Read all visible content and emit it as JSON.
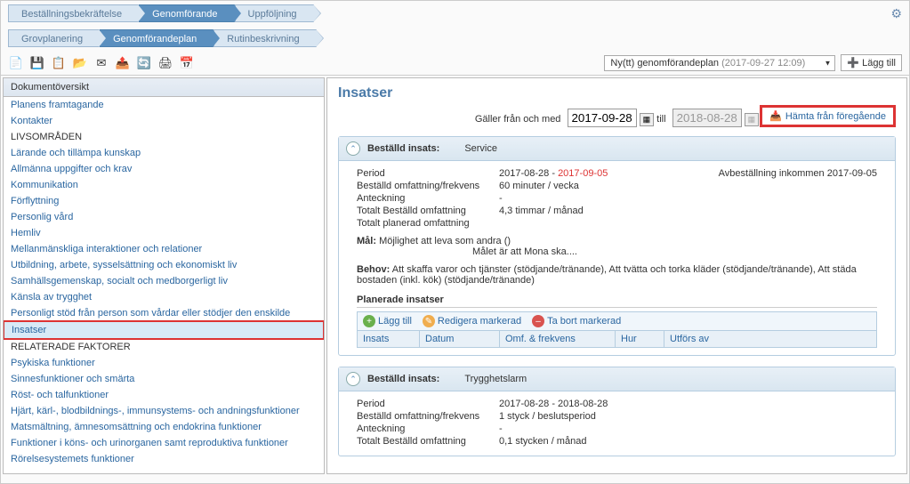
{
  "nav1": {
    "items": [
      "Beställningsbekräftelse",
      "Genomförande",
      "Uppföljning"
    ],
    "active": 1
  },
  "nav2": {
    "items": [
      "Grovplanering",
      "Genomförandeplan",
      "Rutinbeskrivning"
    ],
    "active": 1
  },
  "toolbar": {
    "version_label": "Ny(tt) genomförandeplan",
    "version_time": "(2017-09-27 12:09)",
    "lagg_till": "Lägg till"
  },
  "left": {
    "header": "Dokumentöversikt",
    "items": [
      "Planens framtagande",
      "Kontakter",
      "LIVSOMRÅDEN",
      "Lärande och tillämpa kunskap",
      "Allmänna uppgifter och krav",
      "Kommunikation",
      "Förflyttning",
      "Personlig vård",
      "Hemliv",
      "Mellanmänskliga interaktioner och relationer",
      "Utbildning, arbete, sysselsättning och ekonomiskt liv",
      "Samhällsgemenskap, socialt och medborgerligt liv",
      "Känsla av trygghet",
      "Personligt stöd från person som vårdar eller stödjer den enskilde",
      "Insatser",
      "RELATERADE FAKTORER",
      "Psykiska funktioner",
      "Sinnesfunktioner och smärta",
      "Röst- och talfunktioner",
      "Hjärt, kärl-, blodbildnings-, immunsystems- och andningsfunktioner",
      "Matsmältning, ämnesomsättning och endokrina funktioner",
      "Funktioner i köns- och urinorganen samt reproduktiva funktioner",
      "Rörelsesystemets funktioner"
    ],
    "selected_index": 14
  },
  "right": {
    "title": "Insatser",
    "date_label_from": "Gäller från och med",
    "date_from": "2017-09-28",
    "date_label_to": "till",
    "date_to": "2018-08-28",
    "hamta_btn": "Hämta från föregående",
    "panels": [
      {
        "title": "Beställd insats:",
        "value": "Service",
        "period_label": "Period",
        "period_from": "2017-08-28",
        "period_dash": " - ",
        "period_to": "2017-09-05",
        "avbest": "Avbeställning inkommen 2017-09-05",
        "rows": [
          {
            "label": "Beställd omfattning/frekvens",
            "value": "60 minuter / vecka"
          },
          {
            "label": "Anteckning",
            "value": "-"
          },
          {
            "label": "Totalt Beställd omfattning",
            "value": "4,3 timmar / månad"
          },
          {
            "label": "Totalt planerad omfattning",
            "value": ""
          }
        ],
        "mal_label": "Mål:",
        "mal_text": "Möjlighet att leva som andra ()",
        "mal_sub": "Målet är att Mona ska....",
        "behov_label": "Behov:",
        "behov_text": "Att skaffa varor och tjänster (stödjande/tränande), Att tvätta och torka kläder (stödjande/tränande), Att städa bostaden (inkl. kök) (stödjande/tränande)",
        "planerade_title": "Planerade insatser",
        "actions": {
          "add": "Lägg till",
          "edit": "Redigera markerad",
          "del": "Ta bort markerad"
        },
        "columns": [
          "Insats",
          "Datum",
          "Omf. & frekvens",
          "Hur",
          "Utförs av"
        ]
      },
      {
        "title": "Beställd insats:",
        "value": "Trygghetslarm",
        "period_label": "Period",
        "period_value": "2017-08-28 - 2018-08-28",
        "rows": [
          {
            "label": "Beställd omfattning/frekvens",
            "value": "1 styck / beslutsperiod"
          },
          {
            "label": "Anteckning",
            "value": "-"
          },
          {
            "label": "Totalt Beställd omfattning",
            "value": "0,1 stycken / månad"
          }
        ]
      }
    ]
  }
}
